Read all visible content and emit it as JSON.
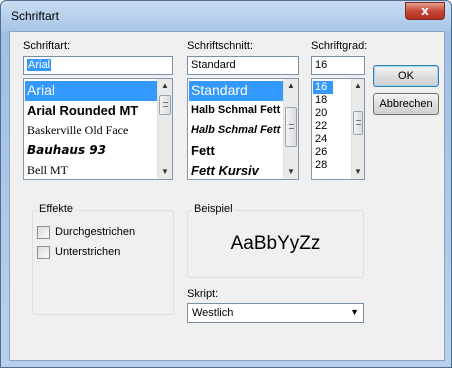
{
  "window": {
    "title": "Schriftart",
    "close_glyph": "x"
  },
  "font": {
    "label": "Schriftart:",
    "value": "Arial",
    "items": [
      {
        "label": "Arial",
        "selected": true
      },
      {
        "label": "Arial Rounded MT",
        "selected": false
      },
      {
        "label": "Baskerville Old Face",
        "selected": false
      },
      {
        "label": "Bauhaus 93",
        "selected": false
      },
      {
        "label": "Bell MT",
        "selected": false
      }
    ]
  },
  "style": {
    "label": "Schriftschnitt:",
    "value": "Standard",
    "items": [
      {
        "label": "Standard",
        "selected": true
      },
      {
        "label": "Halb Schmal Fett",
        "selected": false
      },
      {
        "label": "Halb Schmal Fett",
        "selected": false
      },
      {
        "label": "Fett",
        "selected": false
      },
      {
        "label": "Fett Kursiv",
        "selected": false
      }
    ]
  },
  "size": {
    "label": "Schriftgrad:",
    "value": "16",
    "items": [
      {
        "label": "16",
        "selected": true
      },
      {
        "label": "18",
        "selected": false
      },
      {
        "label": "20",
        "selected": false
      },
      {
        "label": "22",
        "selected": false
      },
      {
        "label": "24",
        "selected": false
      },
      {
        "label": "26",
        "selected": false
      },
      {
        "label": "28",
        "selected": false
      }
    ]
  },
  "buttons": {
    "ok": "OK",
    "cancel": "Abbrechen"
  },
  "effects": {
    "title": "Effekte",
    "strikeout": {
      "label": "Durchgestrichen",
      "checked": false
    },
    "underline": {
      "label": "Unterstrichen",
      "checked": false
    }
  },
  "sample": {
    "title": "Beispiel",
    "text": "AaBbYyZz"
  },
  "script": {
    "label": "Skript:",
    "value": "Westlich"
  },
  "colors": {
    "selection": "#3399ff",
    "title_bar": "#a8c6e8",
    "close_button": "#c8473a"
  }
}
